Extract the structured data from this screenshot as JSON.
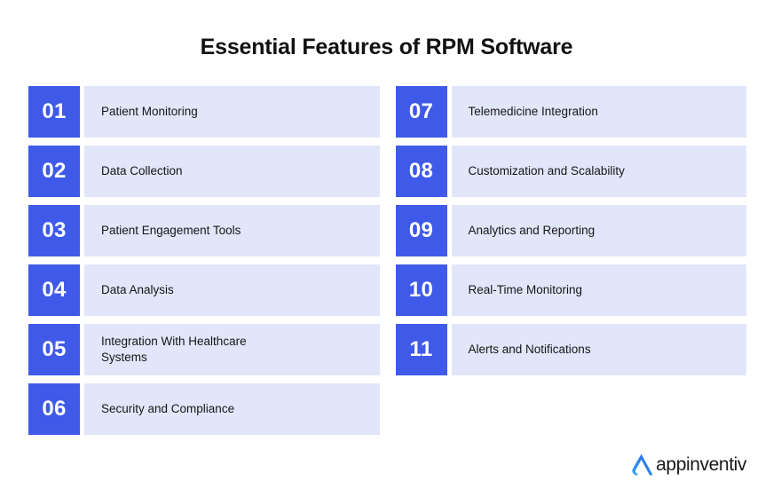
{
  "header": {
    "title": "Essential Features of RPM Software"
  },
  "colors": {
    "badge_blue": "#3F5AE8",
    "panel_lavender": "#E2E6FA",
    "text_dark": "#161616",
    "canvas": "#FFFFFF",
    "logo_blue_light": "#2FA8F5",
    "logo_blue_dark": "#2B62E8"
  },
  "features": {
    "left_column": [
      {
        "number": "01",
        "label": "Patient Monitoring"
      },
      {
        "number": "02",
        "label": "Data Collection"
      },
      {
        "number": "03",
        "label": "Patient Engagement Tools"
      },
      {
        "number": "04",
        "label": "Data Analysis"
      },
      {
        "number": "05",
        "label": "Integration With Healthcare\nSystems"
      },
      {
        "number": "06",
        "label": "Security and Compliance"
      }
    ],
    "right_column": [
      {
        "number": "07",
        "label": "Telemedicine Integration"
      },
      {
        "number": "08",
        "label": "Customization and Scalability"
      },
      {
        "number": "09",
        "label": "Analytics and Reporting"
      },
      {
        "number": "10",
        "label": "Real-Time Monitoring"
      },
      {
        "number": "11",
        "label": "Alerts and Notifications"
      }
    ]
  },
  "logo": {
    "mark": "appinventiv-chevron-icon",
    "text": "appinventiv"
  }
}
